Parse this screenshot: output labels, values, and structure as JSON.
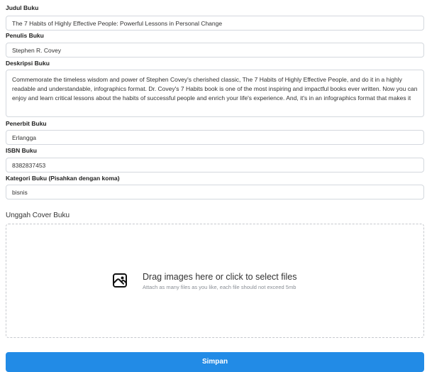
{
  "form": {
    "title_label": "Judul Buku",
    "title_value": "The 7 Habits of Highly Effective People: Powerful Lessons in Personal Change",
    "author_label": "Penulis Buku",
    "author_value": "Stephen R. Covey",
    "description_label": "Deskripsi Buku",
    "description_value": "Commemorate the timeless wisdom and power of Stephen Covey's cherished classic, The 7 Habits of Highly Effective People, and do it in a highly readable and understandable, infographics format. Dr. Covey's 7 Habits book is one of the most inspiring and impactful books ever written. Now you can enjoy and learn critical lessons about the habits of successful people and enrich your life's experience. And, it's in an infographics format that makes it",
    "publisher_label": "Penerbit Buku",
    "publisher_value": "Erlangga",
    "isbn_label": "ISBN Buku",
    "isbn_value": "8382837453",
    "category_label": "Kategori Buku (Pisahkan dengan koma)",
    "category_value": "bisnis"
  },
  "upload": {
    "label": "Unggah Cover Buku",
    "dropzone_title": "Drag images here or click to select files",
    "dropzone_subtitle": "Attach as many files as you like, each file should not exceed 5mb",
    "icon": "photo-icon"
  },
  "actions": {
    "submit_label": "Simpan"
  },
  "colors": {
    "primary": "#228be6",
    "border": "#d4d8de",
    "text": "#333333",
    "muted": "#8a8f96"
  }
}
